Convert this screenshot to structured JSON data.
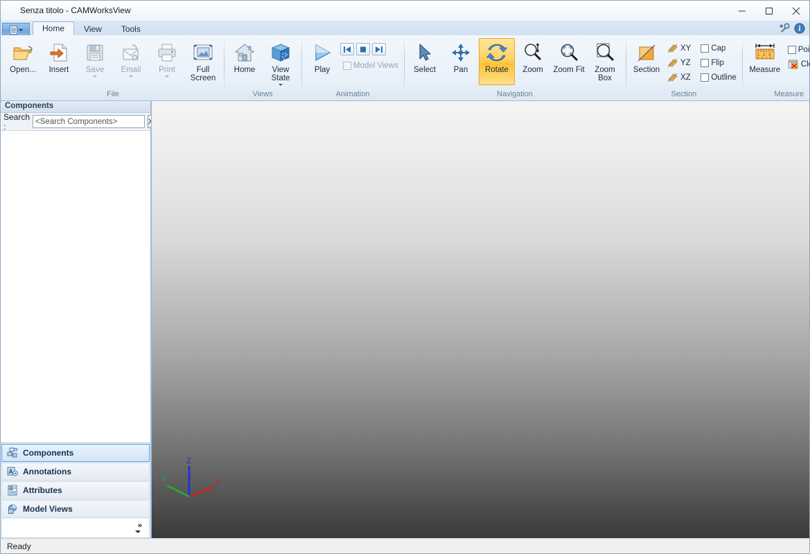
{
  "window": {
    "title": "Senza titolo - CAMWorksView",
    "minimize_label": "–",
    "maximize_label": "☐",
    "close_label": "✕"
  },
  "tabstrip": {
    "app_menu_name": "application-menu",
    "tabs": [
      {
        "label": "Home",
        "active": true
      },
      {
        "label": "View",
        "active": false
      },
      {
        "label": "Tools",
        "active": false
      }
    ],
    "right_icons": [
      {
        "name": "tools-icon"
      },
      {
        "name": "info-icon"
      }
    ]
  },
  "ribbon": {
    "groups": [
      {
        "label": "File",
        "buttons": [
          {
            "label": "Open...",
            "icon": "open-folder-icon",
            "disabled": false,
            "dropdown": false
          },
          {
            "label": "Insert",
            "icon": "insert-document-icon",
            "disabled": false,
            "dropdown": false
          },
          {
            "label": "Save",
            "icon": "save-floppy-icon",
            "disabled": true,
            "dropdown": true
          },
          {
            "label": "Email",
            "icon": "email-envelope-icon",
            "disabled": true,
            "dropdown": true
          },
          {
            "label": "Print",
            "icon": "printer-icon",
            "disabled": true,
            "dropdown": true
          },
          {
            "label": "Full Screen",
            "icon": "full-screen-icon",
            "disabled": false,
            "dropdown": false
          }
        ]
      },
      {
        "label": "Views",
        "buttons": [
          {
            "label": "Home",
            "icon": "home-house-icon",
            "disabled": false,
            "dropdown": false
          },
          {
            "label": "View State",
            "icon": "view-state-cube-icon",
            "disabled": false,
            "dropdown": true
          }
        ]
      },
      {
        "label": "Animation",
        "buttons": [
          {
            "label": "Play",
            "icon": "play-triangle-icon",
            "disabled": false,
            "dropdown": false
          }
        ],
        "transport": [
          {
            "name": "animation-first-button",
            "glyph": "first-frame-icon"
          },
          {
            "name": "animation-stop-button",
            "glyph": "stop-square-icon"
          },
          {
            "name": "animation-last-button",
            "glyph": "last-frame-icon"
          }
        ],
        "checkbox": {
          "label": "Model Views",
          "checked": false,
          "disabled": true
        }
      },
      {
        "label": "Navigation",
        "buttons": [
          {
            "label": "Select",
            "icon": "cursor-arrow-icon",
            "disabled": false,
            "active": false
          },
          {
            "label": "Pan",
            "icon": "pan-move-icon",
            "disabled": false,
            "active": false
          },
          {
            "label": "Rotate",
            "icon": "rotate-arrows-icon",
            "disabled": false,
            "active": true
          },
          {
            "label": "Zoom",
            "icon": "zoom-magnifier-icon",
            "disabled": false,
            "active": false
          },
          {
            "label": "Zoom Fit",
            "icon": "zoom-fit-icon",
            "disabled": false,
            "active": false
          },
          {
            "label": "Zoom Box",
            "icon": "zoom-box-icon",
            "disabled": false,
            "active": false
          }
        ]
      },
      {
        "label": "Section",
        "buttons": [
          {
            "label": "Section",
            "icon": "section-plane-icon",
            "disabled": false
          }
        ],
        "planes": [
          {
            "label": "XY",
            "icon": "section-xy-icon"
          },
          {
            "label": "YZ",
            "icon": "section-yz-icon"
          },
          {
            "label": "XZ",
            "icon": "section-xz-icon"
          }
        ],
        "checkboxes": [
          {
            "label": "Cap",
            "checked": false
          },
          {
            "label": "Flip",
            "checked": false
          },
          {
            "label": "Outline",
            "checked": false
          }
        ]
      },
      {
        "label": "Measure",
        "buttons": [
          {
            "label": "Measure",
            "icon": "measure-ruler-icon",
            "disabled": false
          }
        ],
        "checkbox": {
          "label": "Point",
          "checked": false
        },
        "clear_all": {
          "label": "Clear All",
          "icon": "clear-all-icon"
        }
      }
    ]
  },
  "sidebar": {
    "panel_title": "Components",
    "search": {
      "label": "Search :",
      "value": "",
      "placeholder": "<Search Components>",
      "clear_label": "X"
    },
    "nav_items": [
      {
        "label": "Components",
        "icon": "components-icon",
        "selected": true
      },
      {
        "label": "Annotations",
        "icon": "annotations-icon",
        "selected": false
      },
      {
        "label": "Attributes",
        "icon": "attributes-icon",
        "selected": false
      },
      {
        "label": "Model Views",
        "icon": "model-views-icon",
        "selected": false
      }
    ],
    "overflow_label": "»"
  },
  "viewport": {
    "axis_triad": {
      "x_label": "X",
      "y_label": "Y",
      "z_label": "Z",
      "x_color": "#cc2222",
      "y_color": "#22aa33",
      "z_color": "#2233cc"
    },
    "background_top_color": "#f4f4f4",
    "background_bottom_color": "#3a3a3a"
  },
  "statusbar": {
    "message": "Ready"
  }
}
